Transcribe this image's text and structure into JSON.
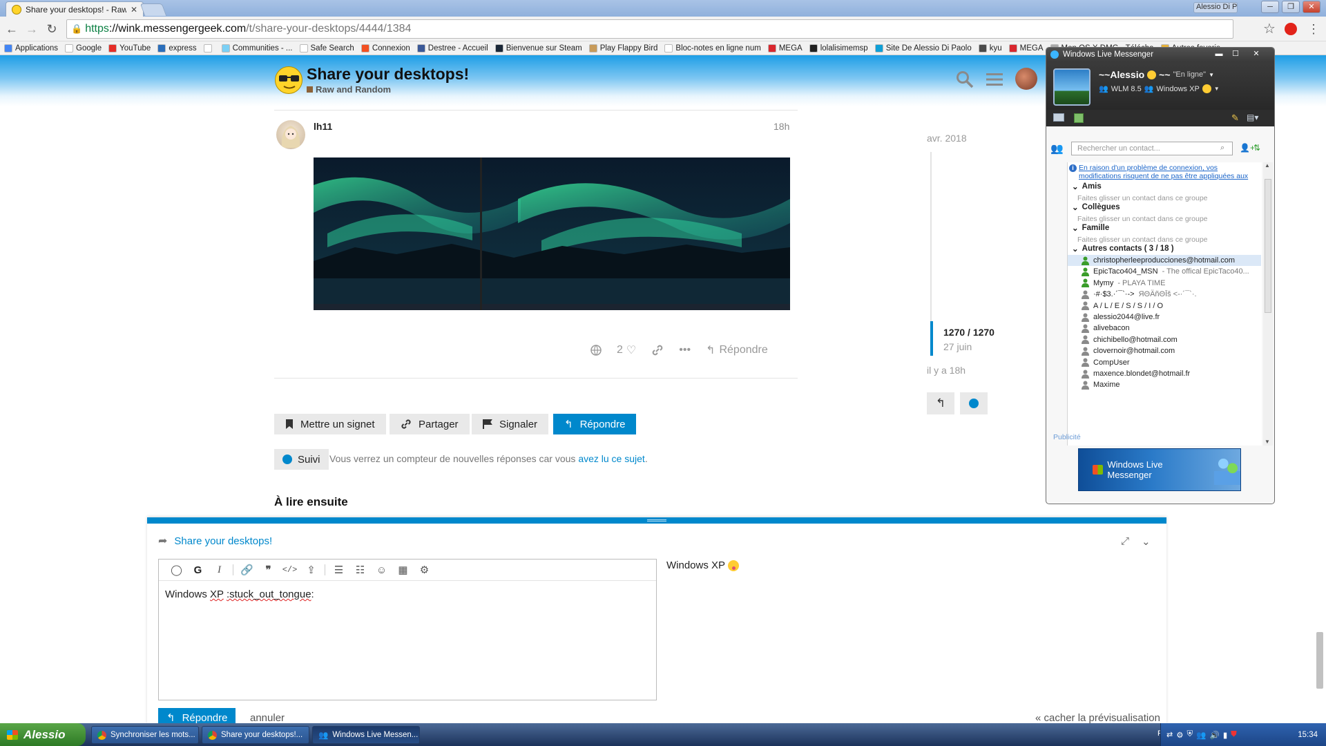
{
  "browser": {
    "tab_title": "Share your desktops! - Raw",
    "window_user": "Alessio Di Pao...",
    "url_https": "https",
    "url_host": "://wink.messengergeek.com",
    "url_path": "/t/share-your-desktops/4444/1384",
    "bookmarks": [
      "Applications",
      "Google",
      "YouTube",
      "express",
      "",
      "Communities - ...",
      "Safe Search",
      "Connexion",
      "Destree - Accueil",
      "Bienvenue sur Steam",
      "Play Flappy Bird",
      "Bloc-notes en ligne num",
      "MEGA",
      "lolalisimemsp",
      "Site De Alessio Di Paolo",
      "kyu",
      "MEGA",
      "Mon OS X DMG - Télécha",
      "Autres favoris"
    ]
  },
  "topic": {
    "title": "Share your desktops!",
    "category": "Raw and Random",
    "post": {
      "username": "lh11",
      "time": "18h",
      "likes": "2",
      "reply_label": "Répondre"
    },
    "actions": {
      "bookmark": "Mettre un signet",
      "share": "Partager",
      "flag": "Signaler",
      "reply": "Répondre"
    },
    "notification": {
      "button": "Suivi",
      "text": "Vous verrez un compteur de nouvelles réponses car vous ",
      "link": "avez lu ce sujet",
      "end": "."
    },
    "read_next": "À lire ensuite"
  },
  "timeline": {
    "date_top": "avr. 2018",
    "count": "1270 / 1270",
    "date_bottom": "27 juin",
    "ago": "il y a 18h"
  },
  "composer": {
    "topic_link": "Share your desktops!",
    "text_before": "Windows ",
    "text_xp": "XP",
    "text_space": " ",
    "text_emoji_code": ":stuck_out_tongue",
    "text_end": ":",
    "preview": "Windows XP",
    "reply_button": "Répondre",
    "cancel": "annuler",
    "hide_preview": "« cacher la prévisualisation"
  },
  "messenger": {
    "window_title": "Windows Live Messenger",
    "display_name": "~~Alessio",
    "suffix": "~~",
    "status": "\"En ligne\"",
    "personal_message_a": "WLM 8.5",
    "personal_message_b": "Windows XP",
    "search_placeholder": "Rechercher un contact...",
    "warning": "En raison d'un problème de connexion, vos modifications risquent de ne pas être appliquées aux",
    "groups": [
      {
        "name": "Amis",
        "empty": "Faites glisser un contact dans ce groupe"
      },
      {
        "name": "Collègues",
        "empty": "Faites glisser un contact dans ce groupe"
      },
      {
        "name": "Famille",
        "empty": "Faites glisser un contact dans ce groupe"
      }
    ],
    "other_group": "Autres contacts ( 3 / 18 )",
    "contacts": [
      {
        "name": "christopherleeproducciones@hotmail.com",
        "sub": "",
        "online": true
      },
      {
        "name": "EpicTaco404_MSN",
        "sub": " - The offical EpicTaco40...",
        "online": true
      },
      {
        "name": "Mymy",
        "sub": " - PLAYA TIME",
        "online": true
      },
      {
        "name": "·#·$3.·´¯`·->",
        "sub": " ЯΘÄñΘĪš <-·´¯`·.",
        "online": false
      },
      {
        "name": "A / L / E / S / S / I / O",
        "sub": "",
        "online": false
      },
      {
        "name": "alessio2044@live.fr",
        "sub": "",
        "online": false
      },
      {
        "name": "alivebacon",
        "sub": "",
        "online": false
      },
      {
        "name": "chichibello@hotmail.com",
        "sub": "",
        "online": false
      },
      {
        "name": "clovernoir@hotmail.com",
        "sub": "",
        "online": false
      },
      {
        "name": "CompUser",
        "sub": "",
        "online": false
      },
      {
        "name": "maxence.blondet@hotmail.fr",
        "sub": "",
        "online": false
      },
      {
        "name": "Maxime",
        "sub": "",
        "online": false
      }
    ],
    "ad_label": "Publicité",
    "ad_text": "Windows Live Messenger"
  },
  "taskbar": {
    "start": "Alessio",
    "tasks": [
      "Synchroniser les mots...",
      "Share your desktops!...",
      "Windows Live Messen..."
    ],
    "lang": "FR",
    "clock": "15:34"
  },
  "colors": {
    "accent": "#0088cc",
    "online": "#3a9d2a",
    "offline": "#8a8a8a"
  }
}
